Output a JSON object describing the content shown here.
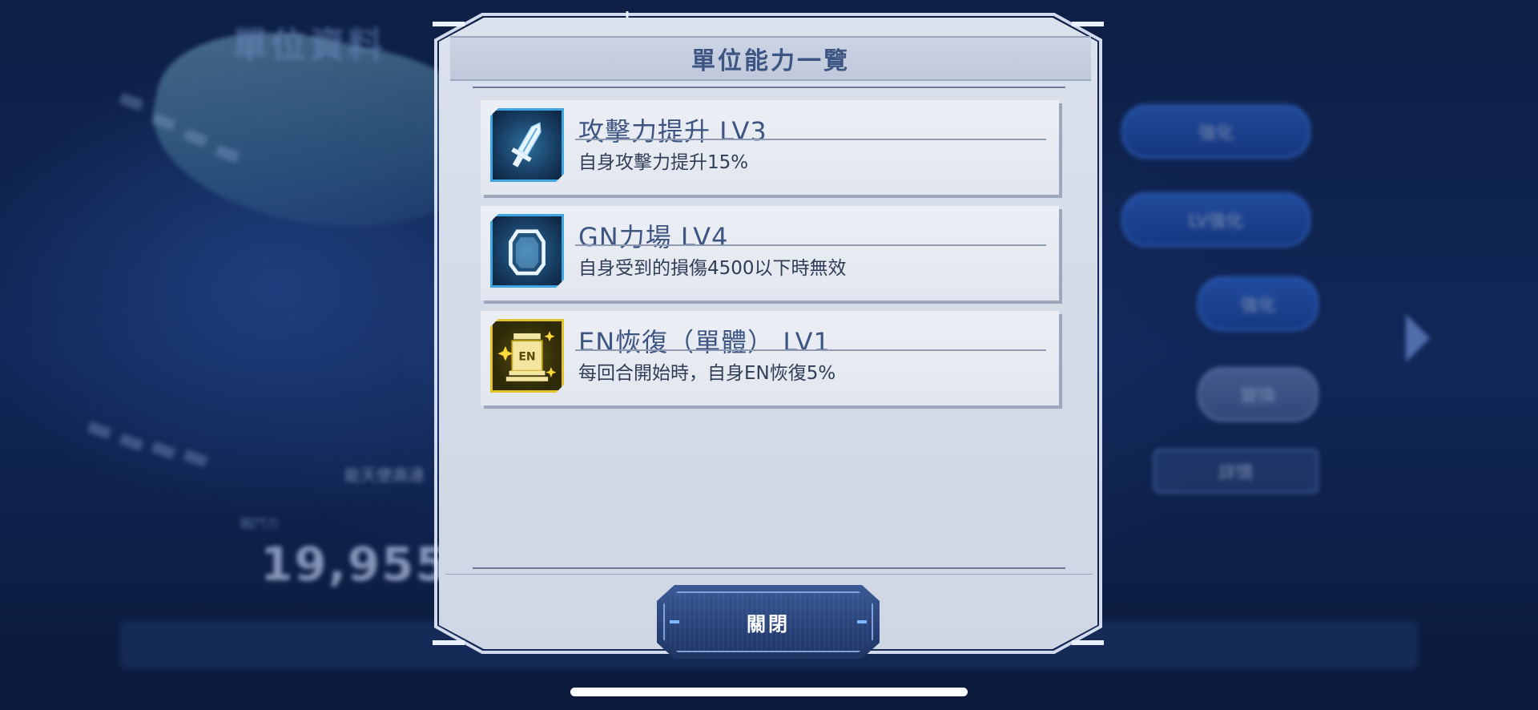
{
  "background": {
    "screen_title": "單位資料",
    "power_label": "戰鬥力",
    "power_value": "19,955",
    "unit_name": "能天使高達",
    "buttons": [
      "強化",
      "LV強化",
      "強化",
      "變換",
      "詳情"
    ]
  },
  "modal": {
    "title": "單位能力一覽",
    "abilities": [
      {
        "name": "攻擊力提升 LV3",
        "description": "自身攻擊力提升15%",
        "icon": "sword-icon",
        "color": "#3fa6e0"
      },
      {
        "name": "GN力場 LV4",
        "description": "自身受到的損傷4500以下時無效",
        "icon": "shield-icon",
        "color": "#3fa6e0"
      },
      {
        "name": "EN恢復（單體） LV1",
        "description": "每回合開始時，自身EN恢復5%",
        "icon": "en-battery-icon",
        "en_badge": "EN",
        "color": "#e2c42a"
      }
    ],
    "close_label": "關閉"
  },
  "colors": {
    "title_text": "#3d5582",
    "panel_bg": "#d3dbe8",
    "button_bg": "#2a4479"
  }
}
